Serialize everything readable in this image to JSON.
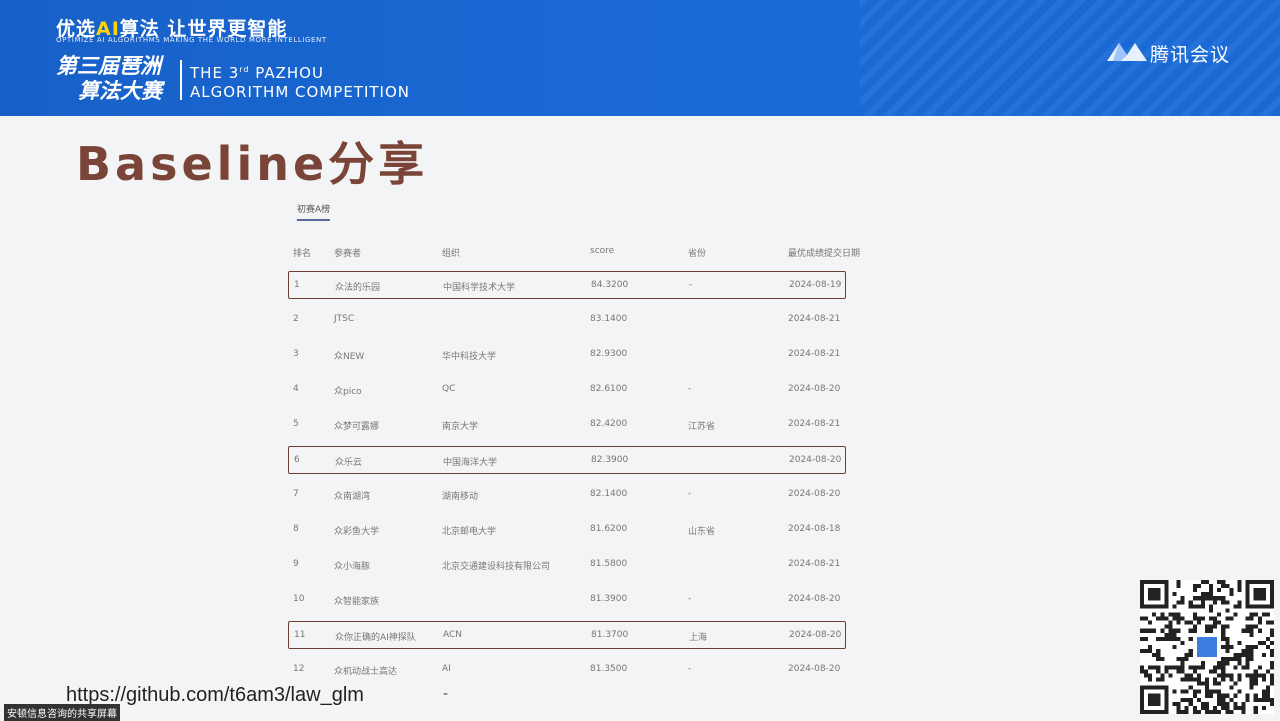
{
  "banner": {
    "slogan_pre": "优选",
    "slogan_ai": "AI",
    "slogan_post": "算法  让世界更智能",
    "slogan_en": "OPTIMIZE AI ALGORITHMS    MAKING THE WORLD MORE INTELLIGENT",
    "cn_title_line1": "第三届琶洲",
    "cn_title_line2": "算法大赛",
    "en_title_line1_pre": "THE 3",
    "en_title_line1_sup": "rd",
    "en_title_line1_post": " PAZHOU",
    "en_title_line2": "ALGORITHM COMPETITION",
    "logo_text": "腾讯会议"
  },
  "heading": "Baseline分享",
  "tab_label": "初赛A榜",
  "table": {
    "headers": [
      "排名",
      "参赛者",
      "组织",
      "score",
      "省份",
      "最优成绩提交日期"
    ],
    "rows": [
      {
        "rank": "1",
        "team": "众法的乐园",
        "org": "中国科学技术大学",
        "score": "84.3200",
        "prov": "-",
        "date": "2024-08-19",
        "hl": true
      },
      {
        "rank": "2",
        "team": "JTSC",
        "org": "",
        "score": "83.1400",
        "prov": "",
        "date": "2024-08-21",
        "hl": false
      },
      {
        "rank": "3",
        "team": "众NEW",
        "org": "华中科技大学",
        "score": "82.9300",
        "prov": "",
        "date": "2024-08-21",
        "hl": false
      },
      {
        "rank": "4",
        "team": "众pico",
        "org": "QC",
        "score": "82.6100",
        "prov": "-",
        "date": "2024-08-20",
        "hl": false
      },
      {
        "rank": "5",
        "team": "众梦可露娜",
        "org": "南京大学",
        "score": "82.4200",
        "prov": "江苏省",
        "date": "2024-08-21",
        "hl": false
      },
      {
        "rank": "6",
        "team": "众乐云",
        "org": "中国海洋大学",
        "score": "82.3900",
        "prov": "",
        "date": "2024-08-20",
        "hl": true
      },
      {
        "rank": "7",
        "team": "众南湖湾",
        "org": "湖南移动",
        "score": "82.1400",
        "prov": "-",
        "date": "2024-08-20",
        "hl": false
      },
      {
        "rank": "8",
        "team": "众彩鱼大学",
        "org": "北京邮电大学",
        "score": "81.6200",
        "prov": "山东省",
        "date": "2024-08-18",
        "hl": false
      },
      {
        "rank": "9",
        "team": "众小海豚",
        "org": "北京交通建设科技有限公司",
        "score": "81.5800",
        "prov": "",
        "date": "2024-08-21",
        "hl": false
      },
      {
        "rank": "10",
        "team": "众智能家族",
        "org": "",
        "score": "81.3900",
        "prov": "-",
        "date": "2024-08-20",
        "hl": false
      },
      {
        "rank": "11",
        "team": "众你正确的AI神探队",
        "org": "ACN",
        "score": "81.3700",
        "prov": "上海",
        "date": "2024-08-20",
        "hl": true
      },
      {
        "rank": "12",
        "team": "众机动战士高达",
        "org": "AI",
        "score": "81.3500",
        "prov": "-",
        "date": "2024-08-20",
        "hl": false
      }
    ]
  },
  "link": "https://github.com/t6am3/law_glm",
  "link_dash": "-",
  "watermark": "安顿信息咨询的共享屏幕",
  "colors": {
    "banner_blue": "#1a66d0",
    "heading_brown": "#7a4538",
    "highlight_border": "#6a4030"
  },
  "icons": [
    "tencent-meeting-logo-icon",
    "qr-code-icon"
  ]
}
